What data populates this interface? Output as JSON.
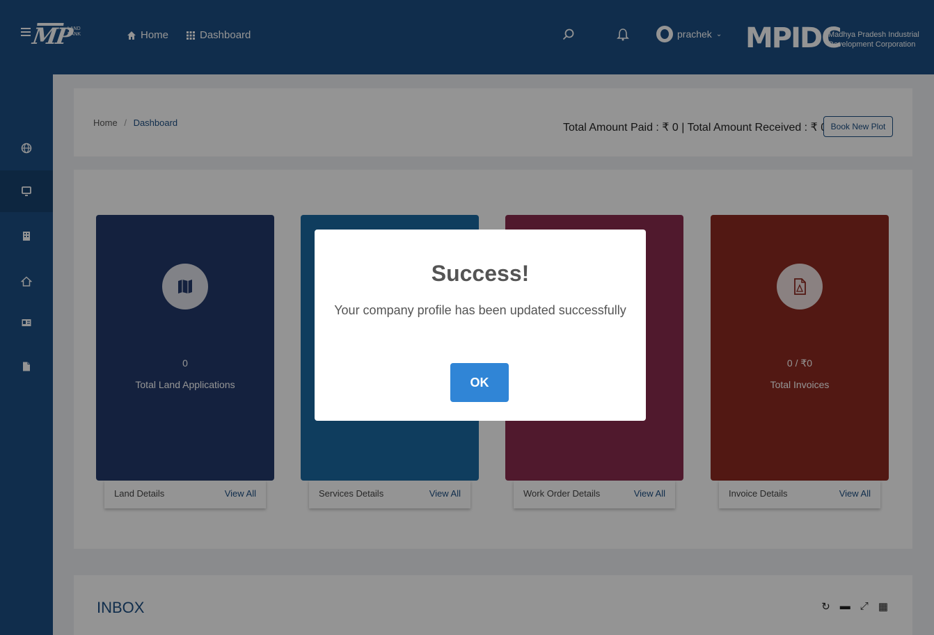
{
  "header": {
    "logo_text": "MP",
    "logo_subtext": [
      "LAND",
      "BANK"
    ],
    "nav_home": "Home",
    "nav_dashboard": "Dashboard",
    "user_name": "prachek",
    "brand_logo": "MPIDC",
    "brand_name_line1": "Madhya Pradesh Industrial",
    "brand_name_line2": "Development Corporation"
  },
  "sidebar": {
    "icons": [
      "globe-icon",
      "monitor-icon",
      "building-icon",
      "home-icon",
      "id-card-icon",
      "document-icon"
    ]
  },
  "breadcrumb": {
    "home": "Home",
    "separator": "/",
    "current": "Dashboard"
  },
  "summary": {
    "amounts_text": "Total Amount Paid : ₹ 0 | Total Amount Received : ₹ 0",
    "book_button": "Book New Plot"
  },
  "cards": [
    {
      "count": "0",
      "label": "Total Land Applications",
      "footer_label": "Land Details",
      "footer_link": "View All",
      "color": "#243a6b"
    },
    {
      "count": "",
      "label": "",
      "footer_label": "Services Details",
      "footer_link": "View All",
      "color": "#1b6aa3"
    },
    {
      "count": "",
      "label": "",
      "footer_label": "Work Order Details",
      "footer_link": "View All",
      "color": "#8a2c4e"
    },
    {
      "count": "0 / ₹0",
      "label": "Total Invoices",
      "footer_label": "Invoice Details",
      "footer_link": "View All",
      "color": "#8e2a21"
    }
  ],
  "inbox": {
    "title": "INBOX"
  },
  "modal": {
    "title": "Success!",
    "message": "Your company profile has been updated successfully",
    "ok_button": "OK"
  }
}
